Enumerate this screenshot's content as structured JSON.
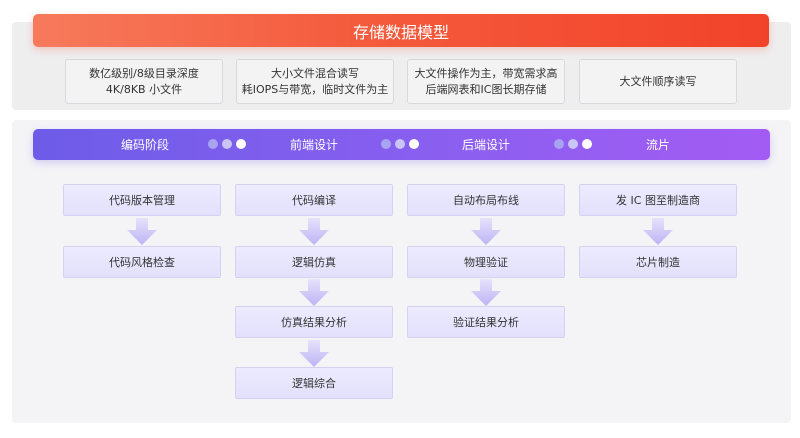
{
  "storage": {
    "title": "存储数据模型",
    "features": [
      {
        "line1": "数亿级别/8级目录深度",
        "line2": "4K/8KB 小文件"
      },
      {
        "line1": "大小文件混合读写",
        "line2": "耗IOPS与带宽，临时文件为主"
      },
      {
        "line1": "大文件操作为主，带宽需求高",
        "line2": "后端网表和IC图长期存储"
      },
      {
        "line1": "大文件顺序读写",
        "line2": ""
      }
    ]
  },
  "flow": {
    "phases": [
      "编码阶段",
      "前端设计",
      "后端设计",
      "流片"
    ],
    "columns": [
      {
        "steps": [
          "代码版本管理",
          "代码风格检查"
        ]
      },
      {
        "steps": [
          "代码编译",
          "逻辑仿真",
          "仿真结果分析",
          "逻辑综合"
        ]
      },
      {
        "steps": [
          "自动布局布线",
          "物理验证",
          "验证结果分析"
        ]
      },
      {
        "steps": [
          "发 IC 图至制造商",
          "芯片制造"
        ]
      }
    ]
  },
  "colors": {
    "header_orange": "#f45a3c",
    "phase_purple": "#7b5eec",
    "arrow_purple": "#c4bdf7"
  }
}
